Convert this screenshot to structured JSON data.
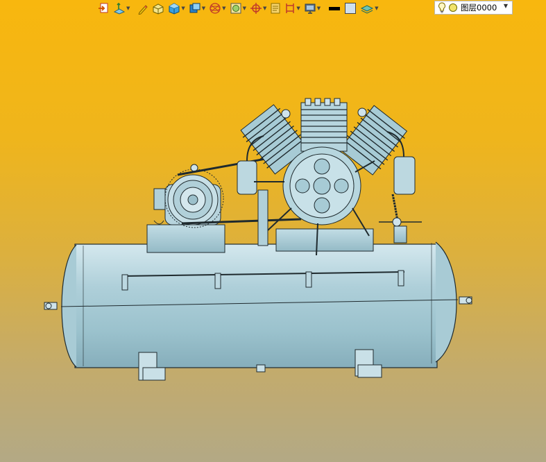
{
  "toolbar": {
    "buttons": [
      {
        "icon": "exit-sketch-icon",
        "dropdown": false
      },
      {
        "icon": "sketch-plane-icon",
        "dropdown": true
      },
      {
        "icon": "pencil-icon",
        "dropdown": false
      },
      {
        "icon": "box-feature-icon",
        "dropdown": false
      },
      {
        "icon": "cube-view-icon",
        "dropdown": true
      },
      {
        "icon": "part-icon",
        "dropdown": true
      },
      {
        "icon": "wireframe-sphere-icon",
        "dropdown": true
      },
      {
        "icon": "render-mode-icon",
        "dropdown": true
      },
      {
        "icon": "orient-icon",
        "dropdown": true
      },
      {
        "icon": "note-icon",
        "dropdown": false
      },
      {
        "icon": "dimension-icon",
        "dropdown": true
      },
      {
        "icon": "monitor-icon",
        "dropdown": true
      },
      {
        "icon": "line-color-icon",
        "dropdown": false
      },
      {
        "icon": "fill-color-icon",
        "dropdown": false
      },
      {
        "icon": "layer-stack-icon",
        "dropdown": true
      }
    ],
    "layer": {
      "value": "图层0000",
      "bulb_icon": "light-bulb-icon",
      "status_icon": "layer-color-dot-icon"
    }
  },
  "colors": {
    "background_top": "#f8b70e",
    "background_bottom": "#b3a985",
    "model_fill": "#a9ccd6",
    "model_edge": "#1f2a2e"
  }
}
